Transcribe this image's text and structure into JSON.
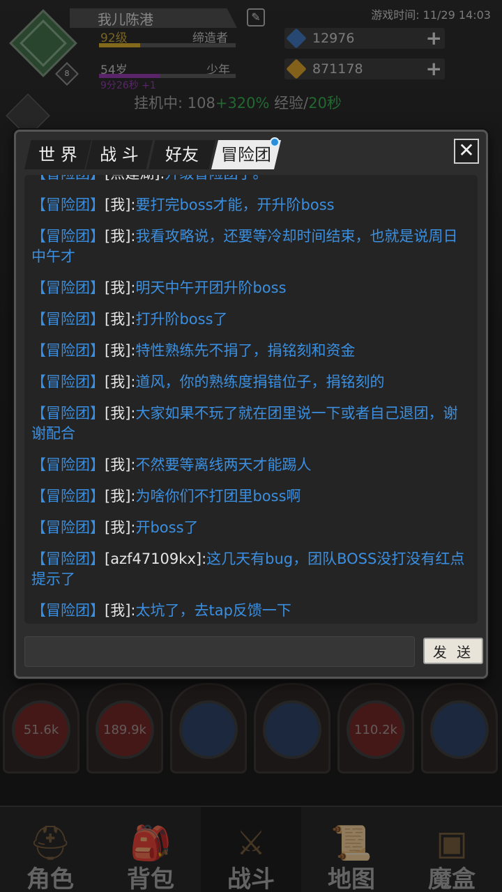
{
  "header": {
    "player_name": "我儿陈港",
    "game_time": "游戏时间: 11/29 14:03",
    "avatar_level": "8",
    "level": "92级",
    "title": "缔造者",
    "age": "54岁",
    "life_stage": "少年",
    "age_timer": "9分26秒 +1",
    "level_progress": 0.3,
    "age_progress": 0.45,
    "currencies": [
      {
        "icon": "blue-gem-icon",
        "value": "12976",
        "color": "#3d6fb0"
      },
      {
        "icon": "gold-coin-icon",
        "value": "871178",
        "color": "#c9962a"
      }
    ],
    "idle": {
      "prefix": "挂机中: 108",
      "bonus": "+320%",
      "mid": "经验/",
      "rate": "20秒"
    }
  },
  "chat": {
    "tabs": [
      {
        "label": "世 界",
        "active": false
      },
      {
        "label": "战 斗",
        "active": false
      },
      {
        "label": "好友",
        "active": false
      },
      {
        "label": "冒险团",
        "active": true
      }
    ],
    "close_label": "✕",
    "messages": [
      {
        "channel": "【冒险团】",
        "sender": "[点建湖]:",
        "text": "升级冒险团了。"
      },
      {
        "channel": "【冒险团】",
        "sender": "[我]:",
        "text": "要打完boss才能，开升阶boss"
      },
      {
        "channel": "【冒险团】",
        "sender": "[我]:",
        "text": "我看攻略说，还要等冷却时间结束，也就是说周日中午才"
      },
      {
        "channel": "【冒险团】",
        "sender": "[我]:",
        "text": "明天中午开团升阶boss"
      },
      {
        "channel": "【冒险团】",
        "sender": "[我]:",
        "text": "打升阶boss了"
      },
      {
        "channel": "【冒险团】",
        "sender": "[我]:",
        "text": "特性熟练先不捐了，捐铭刻和资金"
      },
      {
        "channel": "【冒险团】",
        "sender": "[我]:",
        "text": "道风，你的熟练度捐错位子，捐铭刻的"
      },
      {
        "channel": "【冒险团】",
        "sender": "[我]:",
        "text": "大家如果不玩了就在团里说一下或者自己退团，谢谢配合"
      },
      {
        "channel": "【冒险团】",
        "sender": "[我]:",
        "text": "不然要等离线两天才能踢人"
      },
      {
        "channel": "【冒险团】",
        "sender": "[我]:",
        "text": "为啥你们不打团里boss啊"
      },
      {
        "channel": "【冒险团】",
        "sender": "[我]:",
        "text": "开boss了"
      },
      {
        "channel": "【冒险团】",
        "sender": "[azf47109kx]:",
        "text": "这几天有bug，团队BOSS没打没有红点提示了"
      },
      {
        "channel": "【冒险团】",
        "sender": "[我]:",
        "text": "太坑了，去tap反馈一下"
      }
    ],
    "input_value": "",
    "send_label": "发 送"
  },
  "skills": [
    {
      "label": "51.6k",
      "icon": "red-orb-icon",
      "color": "#6a2626"
    },
    {
      "label": "189.9k",
      "icon": "red-orb-icon",
      "color": "#6a2626"
    },
    {
      "label": "",
      "icon": "sword-skill-icon",
      "color": "#2a3e5e"
    },
    {
      "label": "",
      "icon": "wave-skill-icon",
      "color": "#2a3e5e"
    },
    {
      "label": "110.2k",
      "icon": "red-orb-icon",
      "color": "#6a2626"
    },
    {
      "label": "",
      "icon": "ice-skill-icon",
      "color": "#2a3e5e"
    }
  ],
  "nav": [
    {
      "label": "角色",
      "icon": "helmet-icon",
      "glyph": "⛑",
      "active": false
    },
    {
      "label": "背包",
      "icon": "backpack-icon",
      "glyph": "🎒",
      "active": false
    },
    {
      "label": "战斗",
      "icon": "sword-shield-icon",
      "glyph": "⚔",
      "active": true
    },
    {
      "label": "地图",
      "icon": "scroll-map-icon",
      "glyph": "📜",
      "active": false
    },
    {
      "label": "魔盒",
      "icon": "magic-box-icon",
      "glyph": "▣",
      "active": false
    }
  ]
}
